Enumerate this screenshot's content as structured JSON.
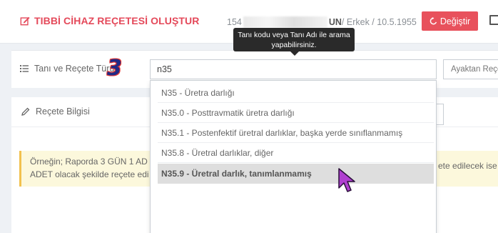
{
  "header": {
    "title": "TIBBİ CİHAZ REÇETESİ OLUŞTUR",
    "patient_id_prefix": "154",
    "patient_surname_suffix": "UN",
    "patient_info": " / Erkek / 10.5.1955",
    "change_button": "Değiştir"
  },
  "tooltip": {
    "line1": "Tanı kodu veya Tanı Adı ile arama",
    "line2": "yapabilirsiniz."
  },
  "diagnosis": {
    "label": "Tanı ve Reçete Türü",
    "step_number": "3",
    "search_value": "n35",
    "type_select": "Ayaktan Reçe"
  },
  "dropdown": {
    "items": [
      "N35 - Üretra darlığı",
      "N35.0 - Posttravmatik üretra darlığı",
      "N35.1 - Postenfektif üretral darlıklar, başka yerde sınıflanmamış",
      "N35.8 - Üretral darlıklar, diğer",
      "N35.9 - Üretral darlık, tanımlanmamış"
    ]
  },
  "prescription": {
    "label": "Reçete Bilgisi"
  },
  "warning": {
    "line1": "Örneğin; Raporda 3 GÜN 1 AD",
    "line2": "ADET olacak şekilde reçete edi",
    "right_text": "ete edilecek ise"
  },
  "colors": {
    "brand_red": "#e4495a",
    "button_red": "#e8515c",
    "tooltip_bg": "#2a2a2a",
    "warning_bg": "#fcf8dc",
    "warning_border": "#f2c14e",
    "cursor_purple": "#b03fd0"
  }
}
